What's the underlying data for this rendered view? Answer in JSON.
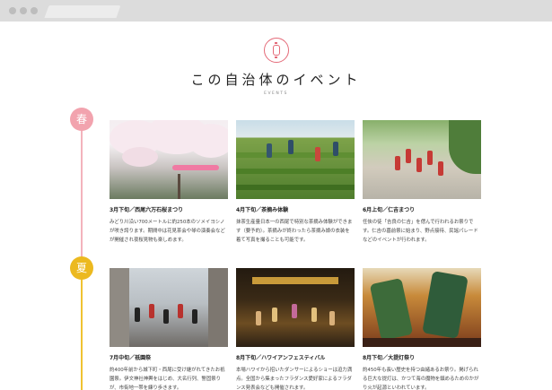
{
  "header": {
    "title": "この自治体のイベント",
    "subtitle": "EVENTS",
    "emblem_icon": "lantern-icon"
  },
  "seasons": [
    {
      "label": "春",
      "color": "#f2a3ae"
    },
    {
      "label": "夏",
      "color": "#ecb91f"
    }
  ],
  "events": {
    "spring": [
      {
        "name": "3月下旬／西尾六万石桜まつり",
        "desc": "みどり川沿い700メートルに約250本のソメイヨシノが咲き誇ります。期間中は花見茶会や琴の演奏会などが開催され夜桜見物も楽しめます。"
      },
      {
        "name": "4月下旬／茶摘み体験",
        "desc": "抹茶生産量日本一の西尾で特別な茶摘み体験ができます（要予約）。茶摘みが終わったら茶摘み娘の衣装を着て写真を撮ることも可能です。"
      },
      {
        "name": "6月上旬／仁吉まつり",
        "desc": "任侠の徒「吉良の仁吉」を偲んで行われるお祭りです。仁吉の墓前祭に始まり、野点接待、民謡パレードなどのイベントが行われます。"
      }
    ],
    "summer": [
      {
        "name": "7月中旬／祇園祭",
        "desc": "約400年前から城下町・西尾に受け継がれてきたお祇園祭。伊文神社神輿をはじめ、大名行列、警固祭りが、市街地一帯を練り歩きます。"
      },
      {
        "name": "8月下旬／ハワイアンフェスティバル",
        "desc": "本場ハワイから招いたダンサーによるショーは迫力満点。全国から集まったフラダンス愛好家によるフラダンス発表会なども開催されます。"
      },
      {
        "name": "8月下旬／大提灯祭り",
        "desc": "約450年も長い歴史を持つ由緒あるお祭り。掲げられる巨大な提灯は、かつて海の魔物を鎮めるためのかがり火が起源といわれています。"
      }
    ]
  }
}
